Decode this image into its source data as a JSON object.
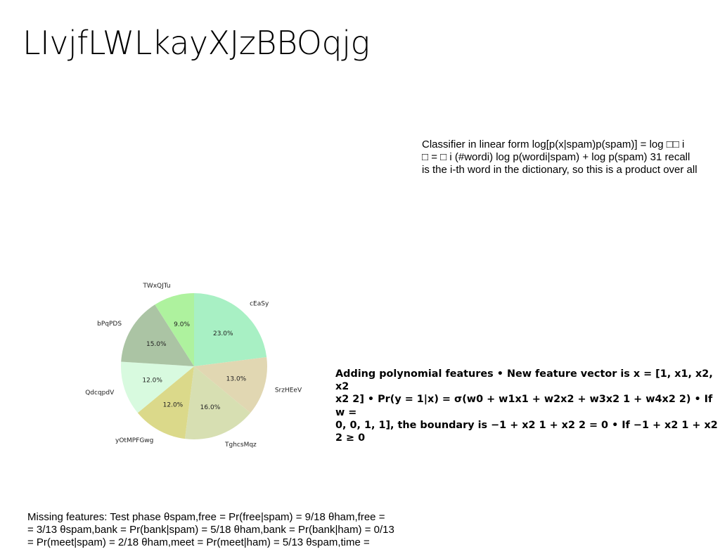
{
  "title": "LIvjfLWLkayXJzBBOqjg",
  "text_blocks": {
    "classifier": "Classifier in linear form log[p(x|spam)p(spam)] = log □□ i\n□ = □ i (#wordi) log p(wordi|spam) + log p(spam) 31 recall\nis the i-th word in the dictionary, so this is a product over all",
    "polynomial": "Adding polynomial features • New feature vector is x = [1, x1, x2, x2\nx2 2] • Pr(y = 1|x) = σ(w0 + w1x1 + w2x2 + w3x2 1 + w4x2 2) • If w =\n0, 0, 1, 1], the boundary is −1 + x2 1 + x2 2 = 0 • If −1 + x2 1 + x2 2 ≥ 0",
    "missing": "Missing features: Test phase θspam,free = Pr(free|spam) = 9/18 θham,free =\n= 3/13 θspam,bank = Pr(bank|spam) = 5/18 θham,bank = Pr(bank|ham) = 0/13\n= Pr(meet|spam) = 2/18 θham,meet = Pr(meet|ham) = 5/13 θspam,time ="
  },
  "chart_data": {
    "type": "pie",
    "start_angle_deg": 90,
    "direction": "clockwise",
    "slices": [
      {
        "label": "cEaSy",
        "value": 23.0,
        "pct_label": "23.0%",
        "color": "#a8f0c4"
      },
      {
        "label": "SrzHEeV",
        "value": 13.0,
        "pct_label": "13.0%",
        "color": "#e1d7b2"
      },
      {
        "label": "TghcsMqz",
        "value": 16.0,
        "pct_label": "16.0%",
        "color": "#d7dfb2"
      },
      {
        "label": "yOtMPFGwg",
        "value": 12.0,
        "pct_label": "12.0%",
        "color": "#dbd98a"
      },
      {
        "label": "QdcqpdV",
        "value": 12.0,
        "pct_label": "12.0%",
        "color": "#d8fadf"
      },
      {
        "label": "bPqPDS",
        "value": 15.0,
        "pct_label": "15.0%",
        "color": "#abc4a4"
      },
      {
        "label": "TWxQJTu",
        "value": 9.0,
        "pct_label": "9.0%",
        "color": "#aef29e"
      }
    ]
  }
}
